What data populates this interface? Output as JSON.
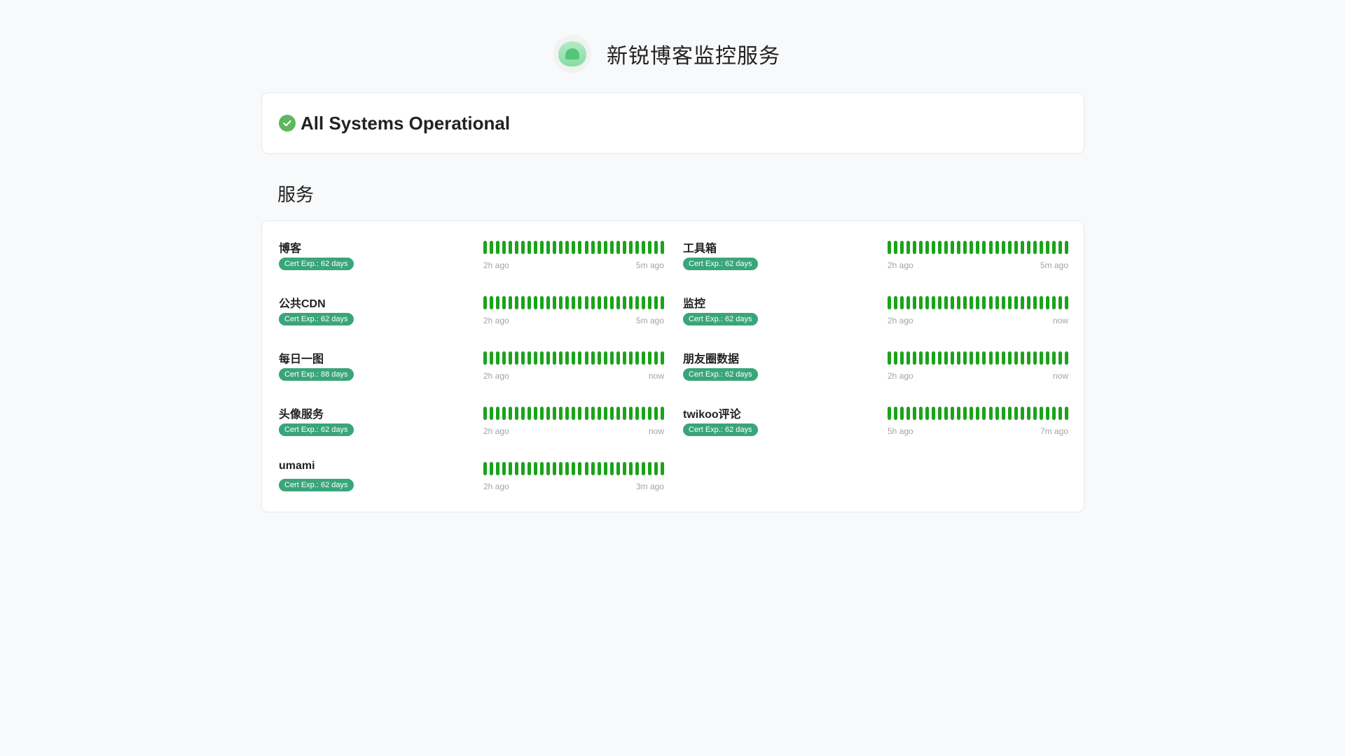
{
  "header": {
    "title": "新锐博客监控服务",
    "logo_icon": "cloud-logo-icon"
  },
  "status": {
    "text": "All Systems Operational",
    "icon": "check-circle-icon",
    "color": "#5cb85c"
  },
  "section": {
    "title": "服务"
  },
  "colors": {
    "up": "#1aa31a",
    "badge": "#3aa57a"
  },
  "services": [
    {
      "name": "博客",
      "badge": "Cert Exp.: 62 days",
      "time_start": "2h ago",
      "time_end": "5m ago"
    },
    {
      "name": "工具箱",
      "badge": "Cert Exp.: 62 days",
      "time_start": "2h ago",
      "time_end": "5m ago"
    },
    {
      "name": "公共CDN",
      "badge": "Cert Exp.: 62 days",
      "time_start": "2h ago",
      "time_end": "5m ago"
    },
    {
      "name": "监控",
      "badge": "Cert Exp.: 62 days",
      "time_start": "2h ago",
      "time_end": "now"
    },
    {
      "name": "每日一图",
      "badge": "Cert Exp.: 88 days",
      "time_start": "2h ago",
      "time_end": "now"
    },
    {
      "name": "朋友圈数据",
      "badge": "Cert Exp.: 62 days",
      "time_start": "2h ago",
      "time_end": "now"
    },
    {
      "name": "头像服务",
      "badge": "Cert Exp.: 62 days",
      "time_start": "2h ago",
      "time_end": "now"
    },
    {
      "name": "twikoo评论",
      "badge": "Cert Exp.: 62 days",
      "time_start": "5h ago",
      "time_end": "7m ago"
    },
    {
      "name": "umami",
      "badge": "Cert Exp.: 62 days",
      "time_start": "2h ago",
      "time_end": "3m ago"
    }
  ]
}
